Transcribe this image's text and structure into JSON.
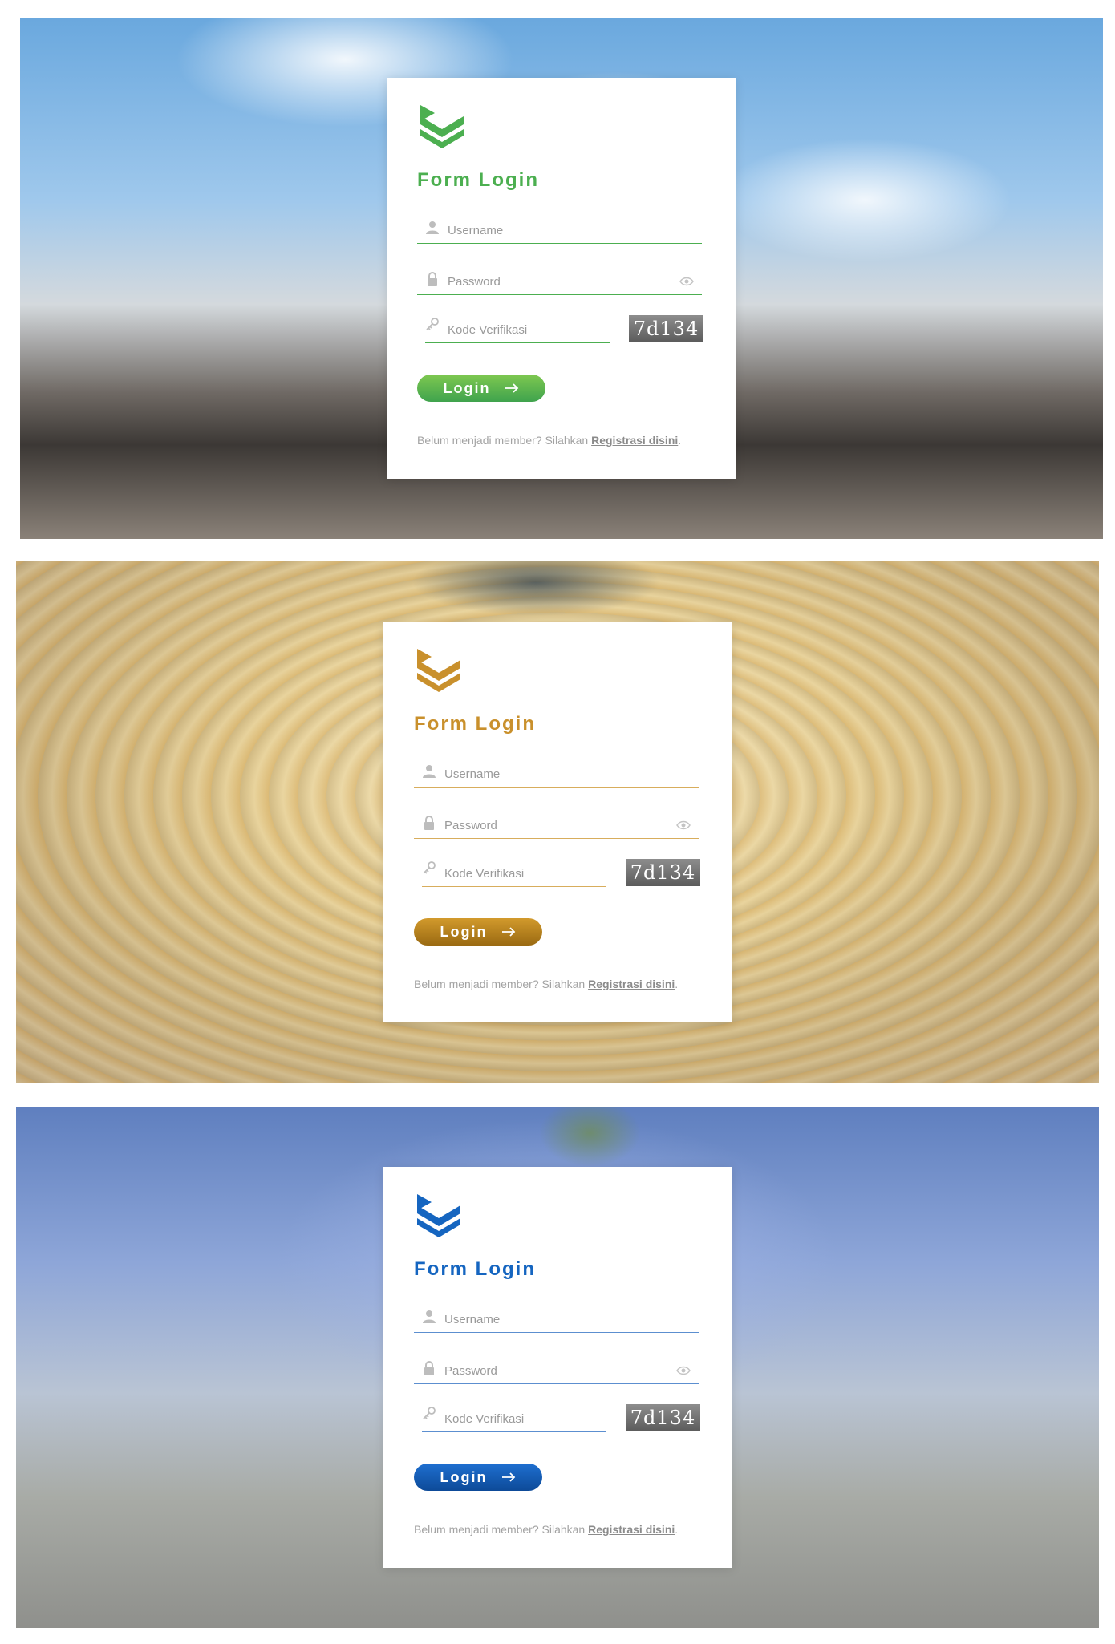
{
  "screens": [
    {
      "theme": "green",
      "accent": "#4caf50",
      "button_gradient": [
        "#7ec850",
        "#3fa34d"
      ],
      "title": "Form Login",
      "username_placeholder": "Username",
      "password_placeholder": "Password",
      "code_placeholder": "Kode Verifikasi",
      "captcha": "7d134",
      "login_label": "Login",
      "footer_text": "Belum menjadi member? Silahkan ",
      "footer_link": "Registrasi disini",
      "footer_end": "."
    },
    {
      "theme": "gold",
      "accent": "#c9902c",
      "button_gradient": [
        "#d29a2c",
        "#9a6a12"
      ],
      "title": "Form Login",
      "username_placeholder": "Username",
      "password_placeholder": "Password",
      "code_placeholder": "Kode Verifikasi",
      "captcha": "7d134",
      "login_label": "Login",
      "footer_text": "Belum menjadi member? Silahkan ",
      "footer_link": "Registrasi disini",
      "footer_end": "."
    },
    {
      "theme": "blue",
      "accent": "#1565c0",
      "button_gradient": [
        "#1e6fd0",
        "#0d4a98"
      ],
      "title": "Form Login",
      "username_placeholder": "Username",
      "password_placeholder": "Password",
      "code_placeholder": "Kode Verifikasi",
      "captcha": "7d134",
      "login_label": "Login",
      "footer_text": "Belum menjadi member? Silahkan ",
      "footer_link": "Registrasi disini",
      "footer_end": "."
    }
  ],
  "icons": {
    "logo": "layers-chevron-logo",
    "username": "user-icon",
    "password": "lock-icon",
    "code": "key-icon",
    "toggle": "eye-icon",
    "login": "arrow-right-icon"
  }
}
